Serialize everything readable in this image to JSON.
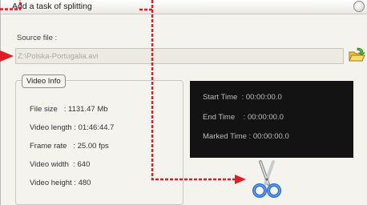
{
  "window": {
    "title": "Add a task of splitting"
  },
  "source": {
    "label": "Source file :",
    "value": "Z:\\Polska-Portugalia.avi"
  },
  "video_info": {
    "legend": "Video Info",
    "file_size": "File size   : 1131.47 Mb",
    "video_length": "Video length : 01:46:44.7",
    "frame_rate": "Frame rate   : 25.00 fps",
    "video_width": "Video width  : 640",
    "video_height": "Video height : 480"
  },
  "times": {
    "start": "Start Time  : 00:00:00.0",
    "end": "End Time    : 00:00:00.0",
    "marked": "Marked Time : 00:00:00.0"
  },
  "colors": {
    "annotation": "#dd1f26",
    "panel": "#131313",
    "window": "#f4f3ee"
  },
  "icons": {
    "folder": "open-folder-icon",
    "scissors": "scissors-icon",
    "close": "close-icon"
  }
}
